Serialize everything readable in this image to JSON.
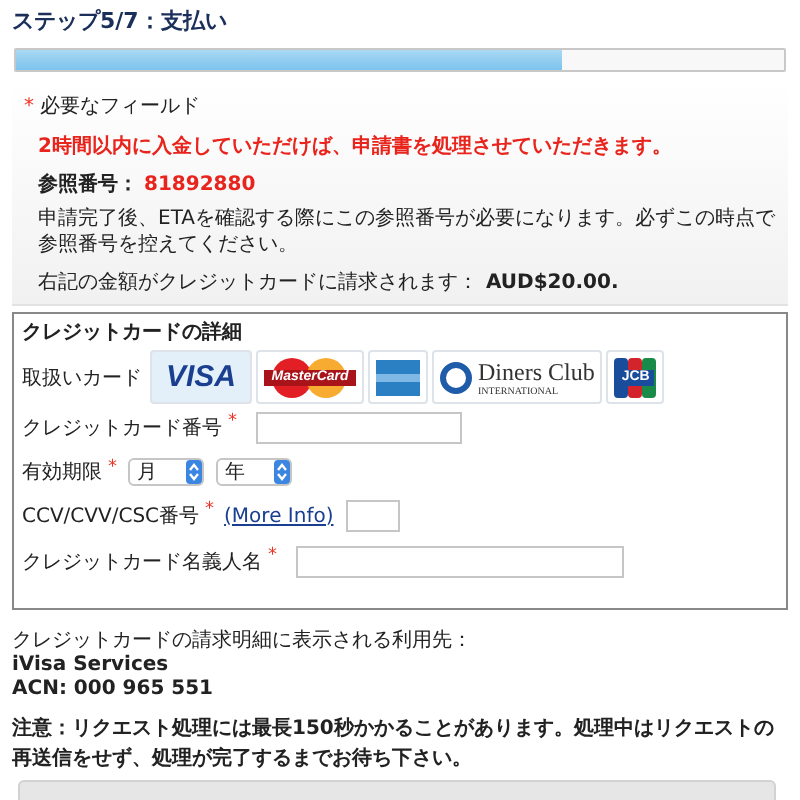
{
  "title": "ステップ5/7：支払い",
  "progress": {
    "level": 0.71
  },
  "required_note": {
    "mark": "*",
    "label": "必要なフィールド"
  },
  "deadline_notice": "2時間以内に入金していただけば、申請書を処理させていただきます。",
  "reference": {
    "label": "参照番号：",
    "number": "81892880"
  },
  "reference_note": "申請完了後、ETAを確認する際にこの参照番号が必要になります。必ずこの時点で参照番号を控えてください。",
  "amount": {
    "label": "右記の金額がクレジットカードに請求されます：",
    "value": "AUD$20.00."
  },
  "card_details": {
    "title": "クレジットカードの詳細",
    "accepted_label": "取扱いカード",
    "cards": [
      {
        "kind": "visa",
        "texts": [
          "VISA"
        ],
        "selected": true
      },
      {
        "kind": "mastercard",
        "texts": [
          "MasterCard"
        ],
        "selected": false
      },
      {
        "kind": "amex",
        "selected": false
      },
      {
        "kind": "diners",
        "texts": [
          "Diners Club",
          "INTERNATIONAL"
        ],
        "selected": false
      },
      {
        "kind": "jcb",
        "texts": [
          "JCB"
        ],
        "selected": false
      }
    ],
    "fields": [
      {
        "kind": "card_number",
        "label": "クレジットカード番号",
        "required": true
      },
      {
        "kind": "expiry",
        "label": "有効期限",
        "required": true,
        "selects": [
          {
            "value": "月"
          },
          {
            "value": "年"
          }
        ]
      },
      {
        "kind": "cvv",
        "label": "CCV/CVV/CSC番号",
        "required": true,
        "link": "(More Info)"
      },
      {
        "kind": "name",
        "label": "クレジットカード名義人名",
        "required": true
      }
    ]
  },
  "merchant": {
    "label": "クレジットカードの請求明細に表示される利用先：",
    "name": "iVisa Services",
    "acn": "ACN: 000 965 551"
  },
  "caution": "注意：リクエスト処理には最長150秒かかることがあります。処理中はリクエストの再送信をせず、処理が完了するまでお待ち下さい。"
}
